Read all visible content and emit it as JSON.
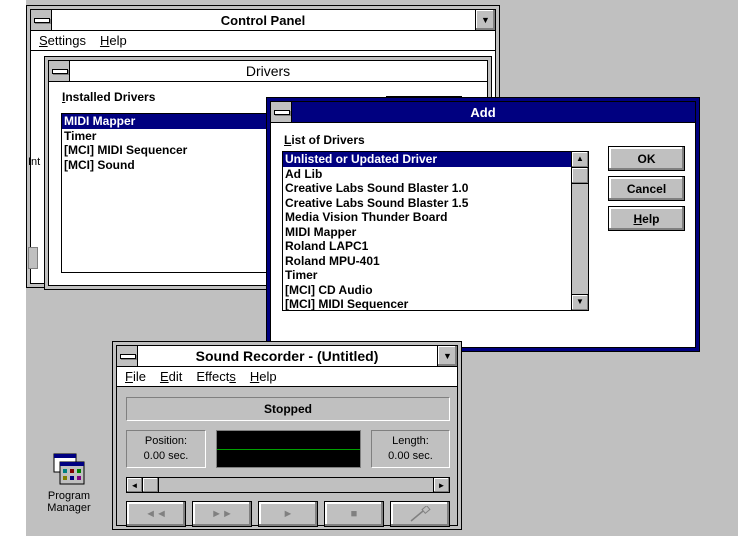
{
  "control_panel": {
    "title": "Control Panel",
    "menu": [
      "Settings",
      "Help"
    ],
    "side_text": "Int"
  },
  "drivers": {
    "title": "Drivers",
    "installed_label": "Installed Drivers",
    "items": [
      "MIDI Mapper",
      "Timer",
      "[MCI] MIDI Sequencer",
      "[MCI] Sound"
    ]
  },
  "add": {
    "title": "Add",
    "list_label": "List of Drivers",
    "items": [
      "Unlisted or Updated Driver",
      "Ad Lib",
      "Creative Labs Sound Blaster 1.0",
      "Creative Labs Sound Blaster 1.5",
      "Media Vision Thunder Board",
      "MIDI Mapper",
      "Roland LAPC1",
      "Roland MPU-401",
      "Timer",
      "[MCI] CD Audio",
      "[MCI] MIDI Sequencer"
    ],
    "ok_label": "OK",
    "cancel_label": "Cancel",
    "help_label": "Help"
  },
  "sound_recorder": {
    "title": "Sound Recorder - (Untitled)",
    "menu": [
      "File",
      "Edit",
      "Effects",
      "Help"
    ],
    "status": "Stopped",
    "position_label": "Position:",
    "position_value": "0.00 sec.",
    "length_label": "Length:",
    "length_value": "0.00 sec."
  },
  "desktop": {
    "program_manager_line1": "Program",
    "program_manager_line2": "Manager"
  },
  "colors": {
    "desktop": "#c0c0c0",
    "active_title": "#000080",
    "wave_bg": "#000000",
    "wave_line": "#00a000"
  }
}
